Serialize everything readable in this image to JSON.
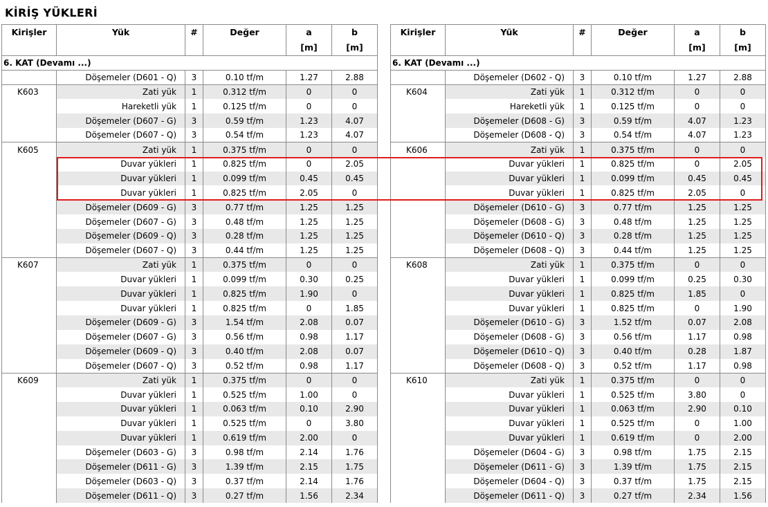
{
  "title": "KİRİŞ YÜKLERİ",
  "headers": {
    "beams": "Kirişler",
    "load": "Yük",
    "num": "#",
    "value": "Değer",
    "a": "a",
    "b": "b",
    "unit_a": "[m]",
    "unit_b": "[m]"
  },
  "section_label": "6. KAT   (Devamı ...)",
  "colors": {
    "highlight": "#e01b1b",
    "row_shade": "#e8e8e8",
    "grid": "#8a8a8a"
  },
  "left_rows": [
    {
      "beam": "",
      "load": "Döşemeler (D601 - Q)",
      "n": "3",
      "value": "0.10 tf/m",
      "a": "1.27",
      "b": "2.88"
    },
    {
      "beam": "K603",
      "load": "Zati yük",
      "n": "1",
      "value": "0.312 tf/m",
      "a": "0",
      "b": "0"
    },
    {
      "beam": "",
      "load": "Hareketli yük",
      "n": "1",
      "value": "0.125 tf/m",
      "a": "0",
      "b": "0"
    },
    {
      "beam": "",
      "load": "Döşemeler (D607 - G)",
      "n": "3",
      "value": "0.59 tf/m",
      "a": "1.23",
      "b": "4.07"
    },
    {
      "beam": "",
      "load": "Döşemeler (D607 - Q)",
      "n": "3",
      "value": "0.54 tf/m",
      "a": "1.23",
      "b": "4.07"
    },
    {
      "beam": "K605",
      "load": "Zati yük",
      "n": "1",
      "value": "0.375 tf/m",
      "a": "0",
      "b": "0"
    },
    {
      "beam": "",
      "load": "Duvar yükleri",
      "n": "1",
      "value": "0.825 tf/m",
      "a": "0",
      "b": "2.05"
    },
    {
      "beam": "",
      "load": "Duvar yükleri",
      "n": "1",
      "value": "0.099 tf/m",
      "a": "0.45",
      "b": "0.45"
    },
    {
      "beam": "",
      "load": "Duvar yükleri",
      "n": "1",
      "value": "0.825 tf/m",
      "a": "2.05",
      "b": "0"
    },
    {
      "beam": "",
      "load": "Döşemeler (D609 - G)",
      "n": "3",
      "value": "0.77 tf/m",
      "a": "1.25",
      "b": "1.25"
    },
    {
      "beam": "",
      "load": "Döşemeler (D607 - G)",
      "n": "3",
      "value": "0.48 tf/m",
      "a": "1.25",
      "b": "1.25"
    },
    {
      "beam": "",
      "load": "Döşemeler (D609 - Q)",
      "n": "3",
      "value": "0.28 tf/m",
      "a": "1.25",
      "b": "1.25"
    },
    {
      "beam": "",
      "load": "Döşemeler (D607 - Q)",
      "n": "3",
      "value": "0.44 tf/m",
      "a": "1.25",
      "b": "1.25"
    },
    {
      "beam": "K607",
      "load": "Zati yük",
      "n": "1",
      "value": "0.375 tf/m",
      "a": "0",
      "b": "0"
    },
    {
      "beam": "",
      "load": "Duvar yükleri",
      "n": "1",
      "value": "0.099 tf/m",
      "a": "0.30",
      "b": "0.25"
    },
    {
      "beam": "",
      "load": "Duvar yükleri",
      "n": "1",
      "value": "0.825 tf/m",
      "a": "1.90",
      "b": "0"
    },
    {
      "beam": "",
      "load": "Duvar yükleri",
      "n": "1",
      "value": "0.825 tf/m",
      "a": "0",
      "b": "1.85"
    },
    {
      "beam": "",
      "load": "Döşemeler (D609 - G)",
      "n": "3",
      "value": "1.54 tf/m",
      "a": "2.08",
      "b": "0.07"
    },
    {
      "beam": "",
      "load": "Döşemeler (D607 - G)",
      "n": "3",
      "value": "0.56 tf/m",
      "a": "0.98",
      "b": "1.17"
    },
    {
      "beam": "",
      "load": "Döşemeler (D609 - Q)",
      "n": "3",
      "value": "0.40 tf/m",
      "a": "2.08",
      "b": "0.07"
    },
    {
      "beam": "",
      "load": "Döşemeler (D607 - Q)",
      "n": "3",
      "value": "0.52 tf/m",
      "a": "0.98",
      "b": "1.17"
    },
    {
      "beam": "K609",
      "load": "Zati yük",
      "n": "1",
      "value": "0.375 tf/m",
      "a": "0",
      "b": "0"
    },
    {
      "beam": "",
      "load": "Duvar yükleri",
      "n": "1",
      "value": "0.525 tf/m",
      "a": "1.00",
      "b": "0"
    },
    {
      "beam": "",
      "load": "Duvar yükleri",
      "n": "1",
      "value": "0.063 tf/m",
      "a": "0.10",
      "b": "2.90"
    },
    {
      "beam": "",
      "load": "Duvar yükleri",
      "n": "1",
      "value": "0.525 tf/m",
      "a": "0",
      "b": "3.80"
    },
    {
      "beam": "",
      "load": "Duvar yükleri",
      "n": "1",
      "value": "0.619 tf/m",
      "a": "2.00",
      "b": "0"
    },
    {
      "beam": "",
      "load": "Döşemeler (D603 - G)",
      "n": "3",
      "value": "0.98 tf/m",
      "a": "2.14",
      "b": "1.76"
    },
    {
      "beam": "",
      "load": "Döşemeler (D611 - G)",
      "n": "3",
      "value": "1.39 tf/m",
      "a": "2.15",
      "b": "1.75"
    },
    {
      "beam": "",
      "load": "Döşemeler (D603 - Q)",
      "n": "3",
      "value": "0.37 tf/m",
      "a": "2.14",
      "b": "1.76"
    },
    {
      "beam": "",
      "load": "Döşemeler (D611 - Q)",
      "n": "3",
      "value": "0.27 tf/m",
      "a": "1.56",
      "b": "2.34"
    }
  ],
  "right_rows": [
    {
      "beam": "",
      "load": "Döşemeler (D602 - Q)",
      "n": "3",
      "value": "0.10 tf/m",
      "a": "1.27",
      "b": "2.88"
    },
    {
      "beam": "K604",
      "load": "Zati yük",
      "n": "1",
      "value": "0.312 tf/m",
      "a": "0",
      "b": "0"
    },
    {
      "beam": "",
      "load": "Hareketli yük",
      "n": "1",
      "value": "0.125 tf/m",
      "a": "0",
      "b": "0"
    },
    {
      "beam": "",
      "load": "Döşemeler (D608 - G)",
      "n": "3",
      "value": "0.59 tf/m",
      "a": "4.07",
      "b": "1.23"
    },
    {
      "beam": "",
      "load": "Döşemeler (D608 - Q)",
      "n": "3",
      "value": "0.54 tf/m",
      "a": "4.07",
      "b": "1.23"
    },
    {
      "beam": "K606",
      "load": "Zati yük",
      "n": "1",
      "value": "0.375 tf/m",
      "a": "0",
      "b": "0"
    },
    {
      "beam": "",
      "load": "Duvar yükleri",
      "n": "1",
      "value": "0.825 tf/m",
      "a": "0",
      "b": "2.05"
    },
    {
      "beam": "",
      "load": "Duvar yükleri",
      "n": "1",
      "value": "0.099 tf/m",
      "a": "0.45",
      "b": "0.45"
    },
    {
      "beam": "",
      "load": "Duvar yükleri",
      "n": "1",
      "value": "0.825 tf/m",
      "a": "2.05",
      "b": "0"
    },
    {
      "beam": "",
      "load": "Döşemeler (D610 - G)",
      "n": "3",
      "value": "0.77 tf/m",
      "a": "1.25",
      "b": "1.25"
    },
    {
      "beam": "",
      "load": "Döşemeler (D608 - G)",
      "n": "3",
      "value": "0.48 tf/m",
      "a": "1.25",
      "b": "1.25"
    },
    {
      "beam": "",
      "load": "Döşemeler (D610 - Q)",
      "n": "3",
      "value": "0.28 tf/m",
      "a": "1.25",
      "b": "1.25"
    },
    {
      "beam": "",
      "load": "Döşemeler (D608 - Q)",
      "n": "3",
      "value": "0.44 tf/m",
      "a": "1.25",
      "b": "1.25"
    },
    {
      "beam": "K608",
      "load": "Zati yük",
      "n": "1",
      "value": "0.375 tf/m",
      "a": "0",
      "b": "0"
    },
    {
      "beam": "",
      "load": "Duvar yükleri",
      "n": "1",
      "value": "0.099 tf/m",
      "a": "0.25",
      "b": "0.30"
    },
    {
      "beam": "",
      "load": "Duvar yükleri",
      "n": "1",
      "value": "0.825 tf/m",
      "a": "1.85",
      "b": "0"
    },
    {
      "beam": "",
      "load": "Duvar yükleri",
      "n": "1",
      "value": "0.825 tf/m",
      "a": "0",
      "b": "1.90"
    },
    {
      "beam": "",
      "load": "Döşemeler (D610 - G)",
      "n": "3",
      "value": "1.52 tf/m",
      "a": "0.07",
      "b": "2.08"
    },
    {
      "beam": "",
      "load": "Döşemeler (D608 - G)",
      "n": "3",
      "value": "0.56 tf/m",
      "a": "1.17",
      "b": "0.98"
    },
    {
      "beam": "",
      "load": "Döşemeler (D610 - Q)",
      "n": "3",
      "value": "0.40 tf/m",
      "a": "0.28",
      "b": "1.87"
    },
    {
      "beam": "",
      "load": "Döşemeler (D608 - Q)",
      "n": "3",
      "value": "0.52 tf/m",
      "a": "1.17",
      "b": "0.98"
    },
    {
      "beam": "K610",
      "load": "Zati yük",
      "n": "1",
      "value": "0.375 tf/m",
      "a": "0",
      "b": "0"
    },
    {
      "beam": "",
      "load": "Duvar yükleri",
      "n": "1",
      "value": "0.525 tf/m",
      "a": "3.80",
      "b": "0"
    },
    {
      "beam": "",
      "load": "Duvar yükleri",
      "n": "1",
      "value": "0.063 tf/m",
      "a": "2.90",
      "b": "0.10"
    },
    {
      "beam": "",
      "load": "Duvar yükleri",
      "n": "1",
      "value": "0.525 tf/m",
      "a": "0",
      "b": "1.00"
    },
    {
      "beam": "",
      "load": "Duvar yükleri",
      "n": "1",
      "value": "0.619 tf/m",
      "a": "0",
      "b": "2.00"
    },
    {
      "beam": "",
      "load": "Döşemeler (D604 - G)",
      "n": "3",
      "value": "0.98 tf/m",
      "a": "1.75",
      "b": "2.15"
    },
    {
      "beam": "",
      "load": "Döşemeler (D611 - G)",
      "n": "3",
      "value": "1.39 tf/m",
      "a": "1.75",
      "b": "2.15"
    },
    {
      "beam": "",
      "load": "Döşemeler (D604 - Q)",
      "n": "3",
      "value": "0.37 tf/m",
      "a": "1.75",
      "b": "2.15"
    },
    {
      "beam": "",
      "load": "Döşemeler (D611 - Q)",
      "n": "3",
      "value": "0.27 tf/m",
      "a": "2.34",
      "b": "1.56"
    }
  ]
}
